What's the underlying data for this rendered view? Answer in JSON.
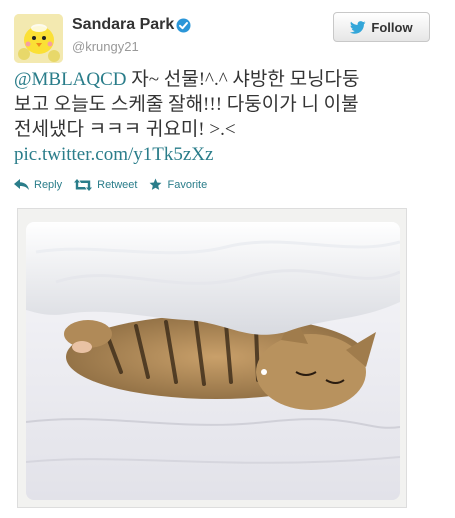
{
  "user": {
    "name": "Sandara Park",
    "screen_name": "@krungy21",
    "verified": true
  },
  "follow_button": {
    "label": "Follow"
  },
  "tweet": {
    "mention": "@MBLAQCD",
    "text_line1": " 자~ 선물!^.^ 샤방한 모닝다둥",
    "text_line2": "보고 오늘도 스케줄 잘해!!! 다둥이가 니 이불",
    "text_line3": "전세냈다 ㅋㅋㅋ 귀요미! >.<",
    "link": "pic.twitter.com/y1Tk5zXz"
  },
  "actions": {
    "reply": "Reply",
    "retweet": "Retweet",
    "favorite": "Favorite"
  },
  "colors": {
    "link": "#2a7d8a",
    "twitter_bird": "#33a6d9",
    "verified": "#2b96d8"
  },
  "media": {
    "icon": "cat-photo"
  }
}
